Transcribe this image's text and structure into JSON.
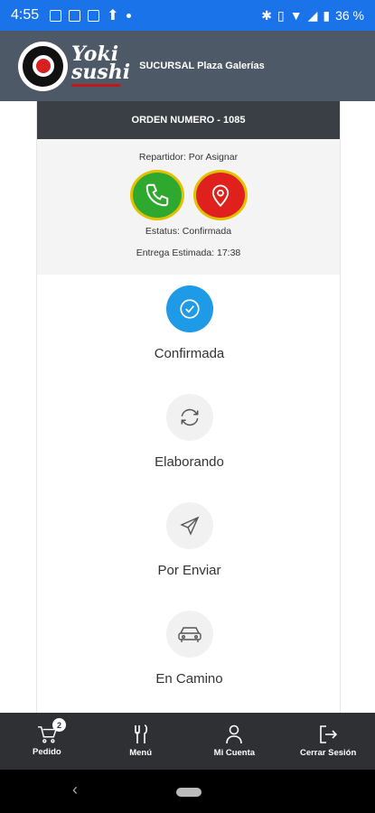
{
  "status_bar": {
    "time": "4:55",
    "battery": "36 %"
  },
  "header": {
    "brand_line1": "Yoki",
    "brand_line2": "sushi",
    "branch": "SUCURSAL Plaza Galerías"
  },
  "order": {
    "title": "ORDEN NUMERO - 1085",
    "courier": "Repartidor: Por Asignar",
    "status": "Estatus: Confirmada",
    "eta": "Entrega Estimada: 17:38"
  },
  "steps": [
    {
      "label": "Confirmada",
      "icon": "check-icon",
      "active": true
    },
    {
      "label": "Elaborando",
      "icon": "refresh-icon",
      "active": false
    },
    {
      "label": "Por Enviar",
      "icon": "send-icon",
      "active": false
    },
    {
      "label": "En Camino",
      "icon": "car-icon",
      "active": false
    }
  ],
  "bottom_nav": {
    "pedido": "Pedido",
    "pedido_badge": "2",
    "menu": "Menú",
    "cuenta": "Mi Cuenta",
    "cerrar": "Cerrar Sesión"
  },
  "colors": {
    "status_bar": "#1a73e8",
    "header": "#4d5966",
    "order_bar": "#3a3f45",
    "active_step": "#1e9ae6",
    "call_button": "#2ea82e",
    "map_button": "#e0201c",
    "bottom_nav": "#2f3034"
  }
}
